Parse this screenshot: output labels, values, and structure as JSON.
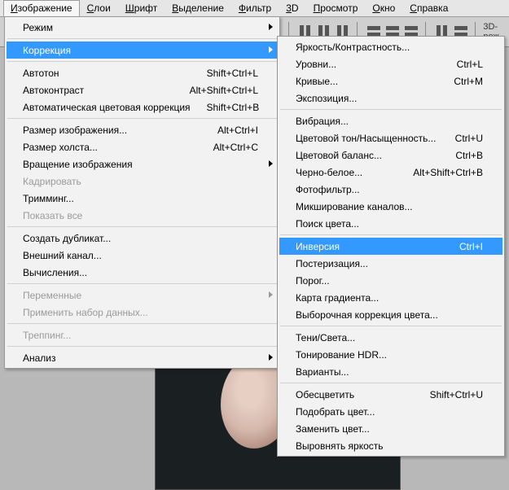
{
  "menubar": {
    "items": [
      {
        "label": "Изображение",
        "active": true
      },
      {
        "label": "Слои"
      },
      {
        "label": "Шрифт"
      },
      {
        "label": "Выделение"
      },
      {
        "label": "Фильтр"
      },
      {
        "label": "3D"
      },
      {
        "label": "Просмотр"
      },
      {
        "label": "Окно"
      },
      {
        "label": "Справка"
      }
    ]
  },
  "toolbar": {
    "mode_label": "3D-реж"
  },
  "primary_menu": [
    {
      "label": "Режим",
      "submenu": true
    },
    {
      "sep": true
    },
    {
      "label": "Коррекция",
      "submenu": true,
      "highlight": true
    },
    {
      "sep": true
    },
    {
      "label": "Автотон",
      "shortcut": "Shift+Ctrl+L"
    },
    {
      "label": "Автоконтраст",
      "shortcut": "Alt+Shift+Ctrl+L"
    },
    {
      "label": "Автоматическая цветовая коррекция",
      "shortcut": "Shift+Ctrl+B"
    },
    {
      "sep": true
    },
    {
      "label": "Размер изображения...",
      "shortcut": "Alt+Ctrl+I"
    },
    {
      "label": "Размер холста...",
      "shortcut": "Alt+Ctrl+C"
    },
    {
      "label": "Вращение изображения",
      "submenu": true
    },
    {
      "label": "Кадрировать",
      "disabled": true
    },
    {
      "label": "Тримминг..."
    },
    {
      "label": "Показать все",
      "disabled": true
    },
    {
      "sep": true
    },
    {
      "label": "Создать дубликат..."
    },
    {
      "label": "Внешний канал..."
    },
    {
      "label": "Вычисления..."
    },
    {
      "sep": true
    },
    {
      "label": "Переменные",
      "submenu": true,
      "disabled": true
    },
    {
      "label": "Применить набор данных...",
      "disabled": true
    },
    {
      "sep": true
    },
    {
      "label": "Треппинг...",
      "disabled": true
    },
    {
      "sep": true
    },
    {
      "label": "Анализ",
      "submenu": true
    }
  ],
  "secondary_menu": [
    {
      "label": "Яркость/Контрастность..."
    },
    {
      "label": "Уровни...",
      "shortcut": "Ctrl+L"
    },
    {
      "label": "Кривые...",
      "shortcut": "Ctrl+M"
    },
    {
      "label": "Экспозиция..."
    },
    {
      "sep": true
    },
    {
      "label": "Вибрация..."
    },
    {
      "label": "Цветовой тон/Насыщенность...",
      "shortcut": "Ctrl+U"
    },
    {
      "label": "Цветовой баланс...",
      "shortcut": "Ctrl+B"
    },
    {
      "label": "Черно-белое...",
      "shortcut": "Alt+Shift+Ctrl+B"
    },
    {
      "label": "Фотофильтр..."
    },
    {
      "label": "Микширование каналов..."
    },
    {
      "label": "Поиск цвета..."
    },
    {
      "sep": true
    },
    {
      "label": "Инверсия",
      "shortcut": "Ctrl+I",
      "highlight": true
    },
    {
      "label": "Постеризация..."
    },
    {
      "label": "Порог..."
    },
    {
      "label": "Карта градиента..."
    },
    {
      "label": "Выборочная коррекция цвета..."
    },
    {
      "sep": true
    },
    {
      "label": "Тени/Света..."
    },
    {
      "label": "Тонирование HDR..."
    },
    {
      "label": "Варианты..."
    },
    {
      "sep": true
    },
    {
      "label": "Обесцветить",
      "shortcut": "Shift+Ctrl+U"
    },
    {
      "label": "Подобрать цвет..."
    },
    {
      "label": "Заменить цвет..."
    },
    {
      "label": "Выровнять яркость"
    }
  ]
}
